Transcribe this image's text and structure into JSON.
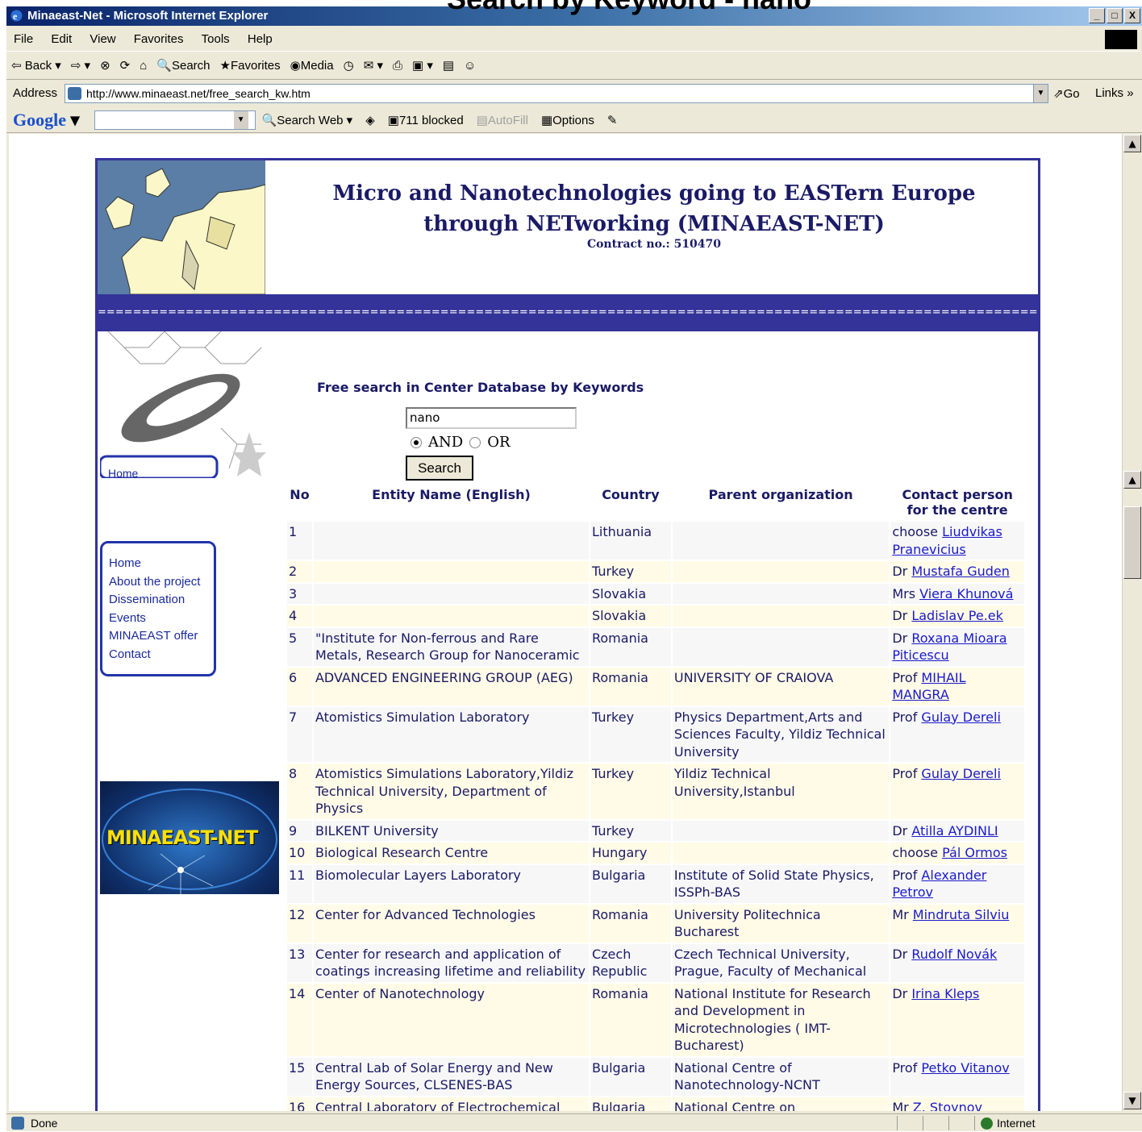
{
  "slide_title": "Search by Keyword - nano",
  "window": {
    "title": "Minaeast-Net - Microsoft Internet Explorer",
    "buttons": [
      "_",
      "□",
      "X"
    ]
  },
  "menu": [
    "File",
    "Edit",
    "View",
    "Favorites",
    "Tools",
    "Help"
  ],
  "toolbar": {
    "back": "Back",
    "search": "Search",
    "favorites": "Favorites",
    "media": "Media"
  },
  "address": {
    "label": "Address",
    "url": "http://www.minaeast.net/free_search_kw.htm",
    "go": "Go",
    "links": "Links"
  },
  "googlebar": {
    "logo": "Google",
    "search_web": "Search Web",
    "blocked": "711 blocked",
    "autofill": "AutoFill",
    "options": "Options"
  },
  "status": {
    "text": "Done",
    "zone": "Internet"
  },
  "page": {
    "header_line1": "Micro and Nanotechnologies going to EASTern Europe",
    "header_line2": "through NETworking (MINAEAST-NET)",
    "contract": "Contract no.: 510470",
    "separator": "=============================================================================================================",
    "nav_home_cut": "Home",
    "nav": [
      "Home",
      "About the project",
      "Dissemination",
      "Events",
      "MINAEAST offer",
      "Contact"
    ],
    "logo_text": "MINAEAST-NET",
    "search_title": "Free search in Center Database by Keywords",
    "keyword": "nano",
    "radio_and": "AND",
    "radio_or": "OR",
    "radio_selected": "AND",
    "search_button": "Search"
  },
  "table": {
    "headers": [
      "No",
      "Entity Name (English)",
      "Country",
      "Parent organization",
      "Contact person for the centre"
    ],
    "rows": [
      {
        "no": "1",
        "entity": "",
        "country": "Lithuania",
        "parent": "",
        "title": "choose",
        "contact": "Liudvikas Pranevicius"
      },
      {
        "no": "2",
        "entity": "",
        "country": "Turkey",
        "parent": "",
        "title": "Dr",
        "contact": "Mustafa Guden"
      },
      {
        "no": "3",
        "entity": "",
        "country": "Slovakia",
        "parent": "",
        "title": "Mrs",
        "contact": "Viera Khunová"
      },
      {
        "no": "4",
        "entity": "",
        "country": "Slovakia",
        "parent": "",
        "title": "Dr",
        "contact": "Ladislav Pe.ek"
      },
      {
        "no": "5",
        "entity": "\"Institute for Non-ferrous and Rare Metals, Research Group for Nanoceramic",
        "country": "Romania",
        "parent": "",
        "title": "Dr",
        "contact": "Roxana Mioara Piticescu"
      },
      {
        "no": "6",
        "entity": "ADVANCED ENGINEERING GROUP (AEG)",
        "country": "Romania",
        "parent": "UNIVERSITY OF CRAIOVA",
        "title": "Prof",
        "contact": "MIHAIL MANGRA"
      },
      {
        "no": "7",
        "entity": "Atomistics Simulation Laboratory",
        "country": "Turkey",
        "parent": "Physics Department,Arts and Sciences Faculty, Yildiz Technical University",
        "title": "Prof",
        "contact": "Gulay Dereli"
      },
      {
        "no": "8",
        "entity": "Atomistics Simulations Laboratory,Yildiz Technical University, Department of Physics",
        "country": "Turkey",
        "parent": "Yildiz Technical University,Istanbul",
        "title": "Prof",
        "contact": "Gulay Dereli"
      },
      {
        "no": "9",
        "entity": "BILKENT University",
        "country": "Turkey",
        "parent": "",
        "title": "Dr",
        "contact": "Atilla AYDINLI"
      },
      {
        "no": "10",
        "entity": "Biological Research Centre",
        "country": "Hungary",
        "parent": "",
        "title": "choose",
        "contact": "Pál Ormos"
      },
      {
        "no": "11",
        "entity": "Biomolecular Layers Laboratory",
        "country": "Bulgaria",
        "parent": "Institute of Solid State Physics, ISSPh-BAS",
        "title": "Prof",
        "contact": "Alexander Petrov"
      },
      {
        "no": "12",
        "entity": "Center for Advanced Technologies",
        "country": "Romania",
        "parent": "University Politechnica Bucharest",
        "title": "Mr",
        "contact": "Mindruta Silviu"
      },
      {
        "no": "13",
        "entity": "Center for research and application of coatings increasing lifetime and reliability",
        "country": "Czech Republic",
        "parent": "Czech Technical University, Prague, Faculty of Mechanical",
        "title": "Dr",
        "contact": "Rudolf Novák"
      },
      {
        "no": "14",
        "entity": "Center of Nanotechnology",
        "country": "Romania",
        "parent": "National Institute for Research and Development in Microtechnologies ( IMT-Bucharest)",
        "title": "Dr",
        "contact": "Irina Kleps"
      },
      {
        "no": "15",
        "entity": "Central Lab of Solar Energy and New Energy Sources, CLSENES-BAS",
        "country": "Bulgaria",
        "parent": "National Centre of Nanotechnology-NCNT",
        "title": "Prof",
        "contact": "Petko Vitanov"
      },
      {
        "no": "16",
        "entity": "Central Laboratory of Electrochemical Power Sources, CLEPS-BAS",
        "country": "Bulgaria",
        "parent": "National Centre on Nanotechnology (NCNT)",
        "title": "Mr",
        "contact": "Z. Stoynov"
      }
    ]
  }
}
